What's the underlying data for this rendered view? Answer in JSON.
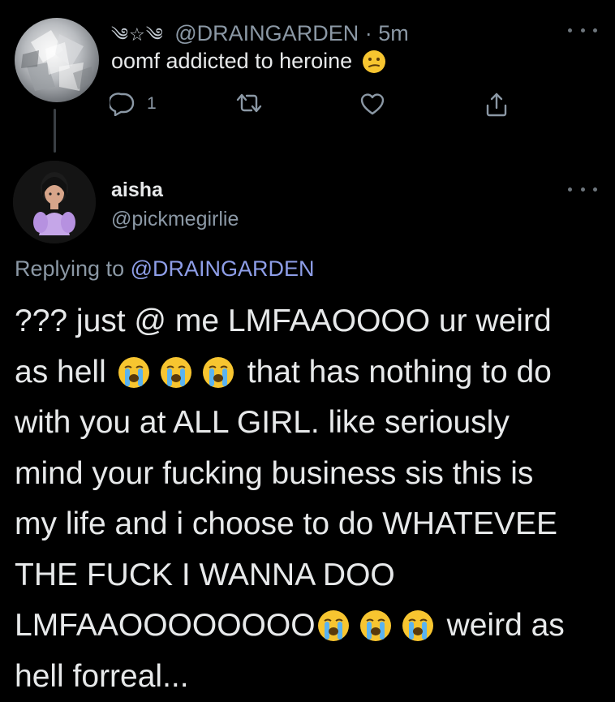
{
  "tweet1": {
    "decoration": "༄☆༄",
    "handle": "@DRAINGARDEN",
    "separator": "·",
    "time": "5m",
    "text": "oomf addicted to heroine",
    "reply_count": "1"
  },
  "tweet2": {
    "display_name": "aisha",
    "handle": "@pickmegirlie",
    "replying_prefix": "Replying to",
    "replying_handle": "@DRAINGARDEN",
    "lines": [
      "??? just @ me LMFAAOOOO ur weird",
      "as hell",
      "that has nothing to do",
      "with you at ALL GIRL. like seriously",
      "mind your fucking business sis this is",
      "my life and i choose to do WHATEVEE",
      "THE FUCK I WANNA DOO",
      "LMFAAOOOOOOOO",
      "weird as",
      "hell forreal..."
    ]
  },
  "icons": {
    "reply": "comment-icon",
    "retweet": "retweet-icon",
    "like": "heart-icon",
    "share": "share-icon",
    "more": "more-icon",
    "emoji_confused": "confused-face-emoji",
    "emoji_cry": "loudly-crying-face-emoji"
  },
  "colors": {
    "background": "#000000",
    "text": "#e7e9ea",
    "secondary": "#8b98a5",
    "mention": "#8e9ee8"
  }
}
